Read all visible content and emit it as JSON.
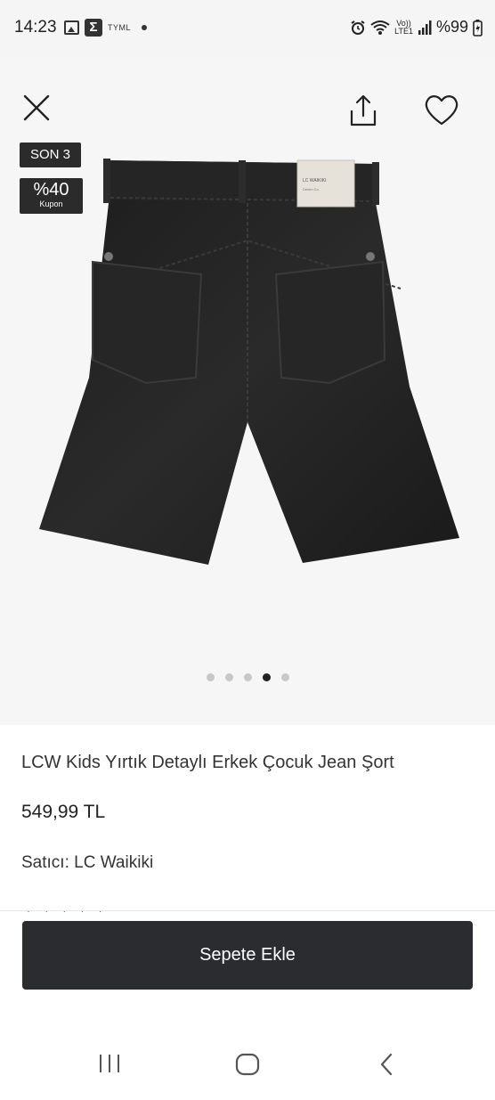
{
  "status_bar": {
    "time": "14:23",
    "carrier_label": "TYML",
    "volte_label": "Vo))\nLTE1",
    "battery_text": "%99"
  },
  "product_gallery": {
    "badge_stock": "SON 3",
    "badge_coupon_value": "%40",
    "badge_coupon_label": "Kupon",
    "image_count": 5,
    "active_image_index": 3
  },
  "product": {
    "title": "LCW Kids Yırtık Detaylı Erkek Çocuk Jean Şort",
    "price": "549,99 TL",
    "seller": "Satıcı: LC Waikiki"
  },
  "actions": {
    "add_to_cart_label": "Sepete Ekle"
  },
  "colors": {
    "primary_button": "#2a2c2f",
    "badge_bg": "#2b2b2b",
    "dot_active": "#222222",
    "dot_inactive": "#c8c8c8"
  }
}
